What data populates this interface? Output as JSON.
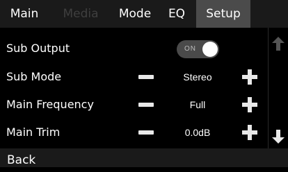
{
  "tabs": [
    {
      "label": "Main",
      "state": "normal"
    },
    {
      "label": "Media",
      "state": "disabled"
    },
    {
      "label": "Mode",
      "state": "normal"
    },
    {
      "label": "EQ",
      "state": "normal"
    },
    {
      "label": "Setup",
      "state": "active"
    }
  ],
  "rows": {
    "sub_output": {
      "label": "Sub Output",
      "toggle_text": "ON",
      "toggle_on": true
    },
    "sub_mode": {
      "label": "Sub Mode",
      "value": "Stereo"
    },
    "main_frequency": {
      "label": "Main Frequency",
      "value": "Full"
    },
    "main_trim": {
      "label": "Main Trim",
      "value": "0.0dB"
    }
  },
  "footer": {
    "back_label": "Back"
  },
  "colors": {
    "background": "#000000",
    "bar": "#1a1a1a",
    "active_tab": "#4b4b4b",
    "disabled_text": "#3f3f3f",
    "scroll_arrow": "#555555",
    "toggle_track": "#4a4a4a"
  },
  "icons": {
    "scroll_up": "arrow-up-icon",
    "scroll_down": "arrow-down-icon",
    "minus": "minus-icon",
    "plus": "plus-icon"
  }
}
